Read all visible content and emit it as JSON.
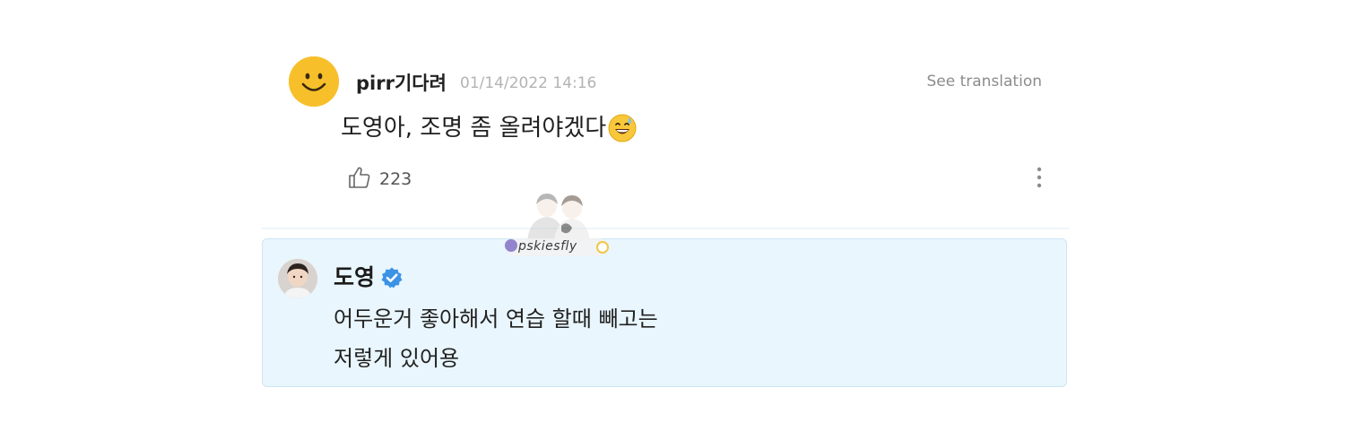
{
  "comment": {
    "avatar_icon": "smiley-face-icon",
    "username": "pirr기다려",
    "timestamp": "01/14/2022 14:16",
    "see_translation_label": "See translation",
    "text": "도영아, 조명 좀 올려야겠다",
    "emoji_icon": "grinning-sweat-emoji",
    "like_icon": "thumbs-up-icon",
    "like_count": "223",
    "more_icon": "vertical-ellipsis-icon"
  },
  "watermark": {
    "text": "pskiesfly"
  },
  "reply": {
    "artist_name": "도영",
    "verified_icon": "verified-check-icon",
    "lines": [
      "어두운거 좋아해서 연습 할때 빼고는",
      "저렇게 있어용"
    ]
  },
  "colors": {
    "reply_background": "#e9f6fd",
    "verified_blue": "#3b93e6",
    "avatar_yellow": "#f7c02b"
  }
}
